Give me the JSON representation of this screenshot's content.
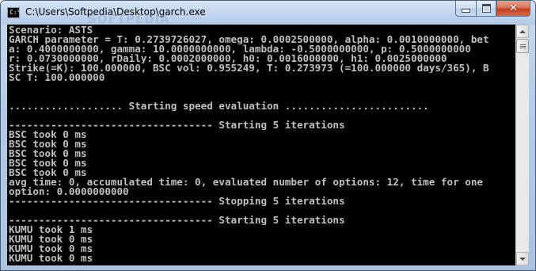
{
  "window": {
    "title": "C:\\Users\\Softpedia\\Desktop\\garch.exe",
    "watermark": "SOFTPEDIA",
    "caption_buttons": {
      "minimize": "minimize",
      "maximize": "maximize",
      "close": "✕"
    }
  },
  "icons": {
    "app_icon": "console-icon",
    "minimize": "minimize-icon",
    "maximize": "maximize-icon",
    "close": "close-icon",
    "scroll_up": "arrow-up-icon",
    "scroll_down": "arrow-down-icon"
  },
  "console": {
    "lines": [
      "Scenario: ASTS",
      "GARCH parameter = T: 0.2739726027, omega: 0.0002500000, alpha: 0.0010000000, bet",
      "a: 0.4000000000, gamma: 10.0000000000, lambda: -0.5000000000, p: 0.5000000000",
      "r: 0.0730000000, rDaily: 0.0002000000, h0: 0.0016000000, h1: 0.0025000000",
      "Strike(=K): 100.000000, BSC vol: 0.955249, T: 0.273973 (=100.000000 days/365), B",
      "SC T: 100.000000",
      "",
      "",
      "................... Starting speed evaluation ........................",
      "",
      "---------------------------------- Starting 5 iterations",
      "BSC took 0 ms",
      "BSC took 0 ms",
      "BSC took 0 ms",
      "BSC took 0 ms",
      "BSC took 0 ms",
      "avg time: 0, accumulated time: 0, evaluated number of options: 12, time for one",
      "option: 0.0000000000",
      "---------------------------------- Stopping 5 iterations",
      "",
      "---------------------------------- Starting 5 iterations",
      "KUMU took 1 ms",
      "KUMU took 0 ms",
      "KUMU took 0 ms",
      "KUMU took 0 ms"
    ]
  },
  "colors": {
    "console_background": "#000000",
    "console_text": "#c0c0c0",
    "close_button": "#c43d1b",
    "titlebar": "#c2d6ee"
  }
}
